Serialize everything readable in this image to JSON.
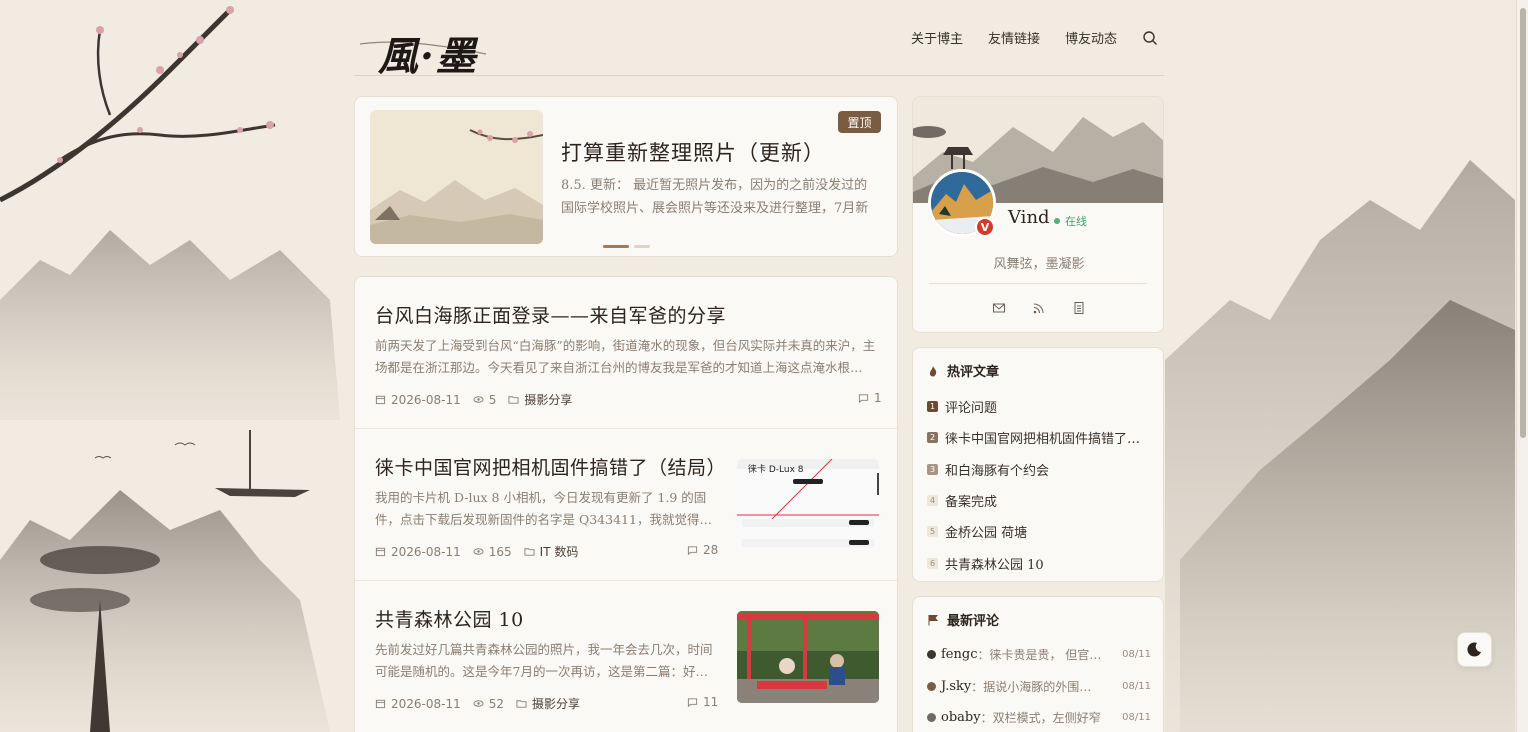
{
  "site": {
    "logo_text": "風·墨"
  },
  "nav": {
    "items": [
      "关于博主",
      "友情链接",
      "博友动态"
    ]
  },
  "featured": {
    "badge": "置顶",
    "title": "打算重新整理照片（更新）",
    "excerpt": "8.5. 更新： 最近暂无照片发布，因为的之前没发过的国际学校照片、展会照片等还没来及进行整理，7月新拍…"
  },
  "posts": [
    {
      "title": "台风白海豚正面登录——来自军爸的分享",
      "excerpt": "前两天发了上海受到台风“白海豚”的影响，街道淹水的现象，但台风实际并未真的来沪，主场都是在浙江那边。今天看见了来自浙江台州的博友我是军爸的才知道上海这点淹水根…",
      "date": "2026-08-11",
      "views": "5",
      "category": "摄影分享",
      "comments": "1"
    },
    {
      "title": "徕卡中国官网把相机固件搞错了（结局）",
      "excerpt": "我用的卡片机 D-lux 8 小相机，今日发现有更新了 1.9 的固件，点击下载后发现新固件的名字是 Q343411，我就觉得…",
      "date": "2026-08-11",
      "views": "165",
      "category": "IT 数码",
      "comments": "28",
      "thumb_text": "徕卡 D-Lux 8"
    },
    {
      "title": "共青森林公园 10",
      "excerpt": "先前发过好几篇共青森林公园的照片，我一年会去几次，时间可能是随机的。这是今年7月的一次再访，这是第二篇：好…",
      "date": "2026-08-11",
      "views": "52",
      "category": "摄影分享",
      "comments": "11"
    }
  ],
  "profile": {
    "name": "Vind",
    "status": "在线",
    "badge": "V",
    "motto": "风舞弦，墨凝影"
  },
  "hot": {
    "title": "热评文章",
    "items": [
      "评论问题",
      "徕卡中国官网把相机固件搞错了（…",
      "和白海豚有个约会",
      "备案完成",
      "金桥公园 荷塘",
      "共青森林公园 10"
    ],
    "ranks": [
      "1",
      "2",
      "3",
      "4",
      "5",
      "6"
    ]
  },
  "recent": {
    "title": "最新评论",
    "items": [
      {
        "user": "fengc",
        "text": "：徕卡贵是贵， 但官网…",
        "date": "08/11"
      },
      {
        "user": "J.sky",
        "text": "：据说小海豚的外围还…",
        "date": "08/11"
      },
      {
        "user": "obaby",
        "text": "：双栏模式，左侧好窄",
        "date": "08/11"
      }
    ]
  },
  "colors": {
    "accent": "#7a5c43",
    "online": "#4fb07a",
    "vbadge": "#d33a2c"
  }
}
